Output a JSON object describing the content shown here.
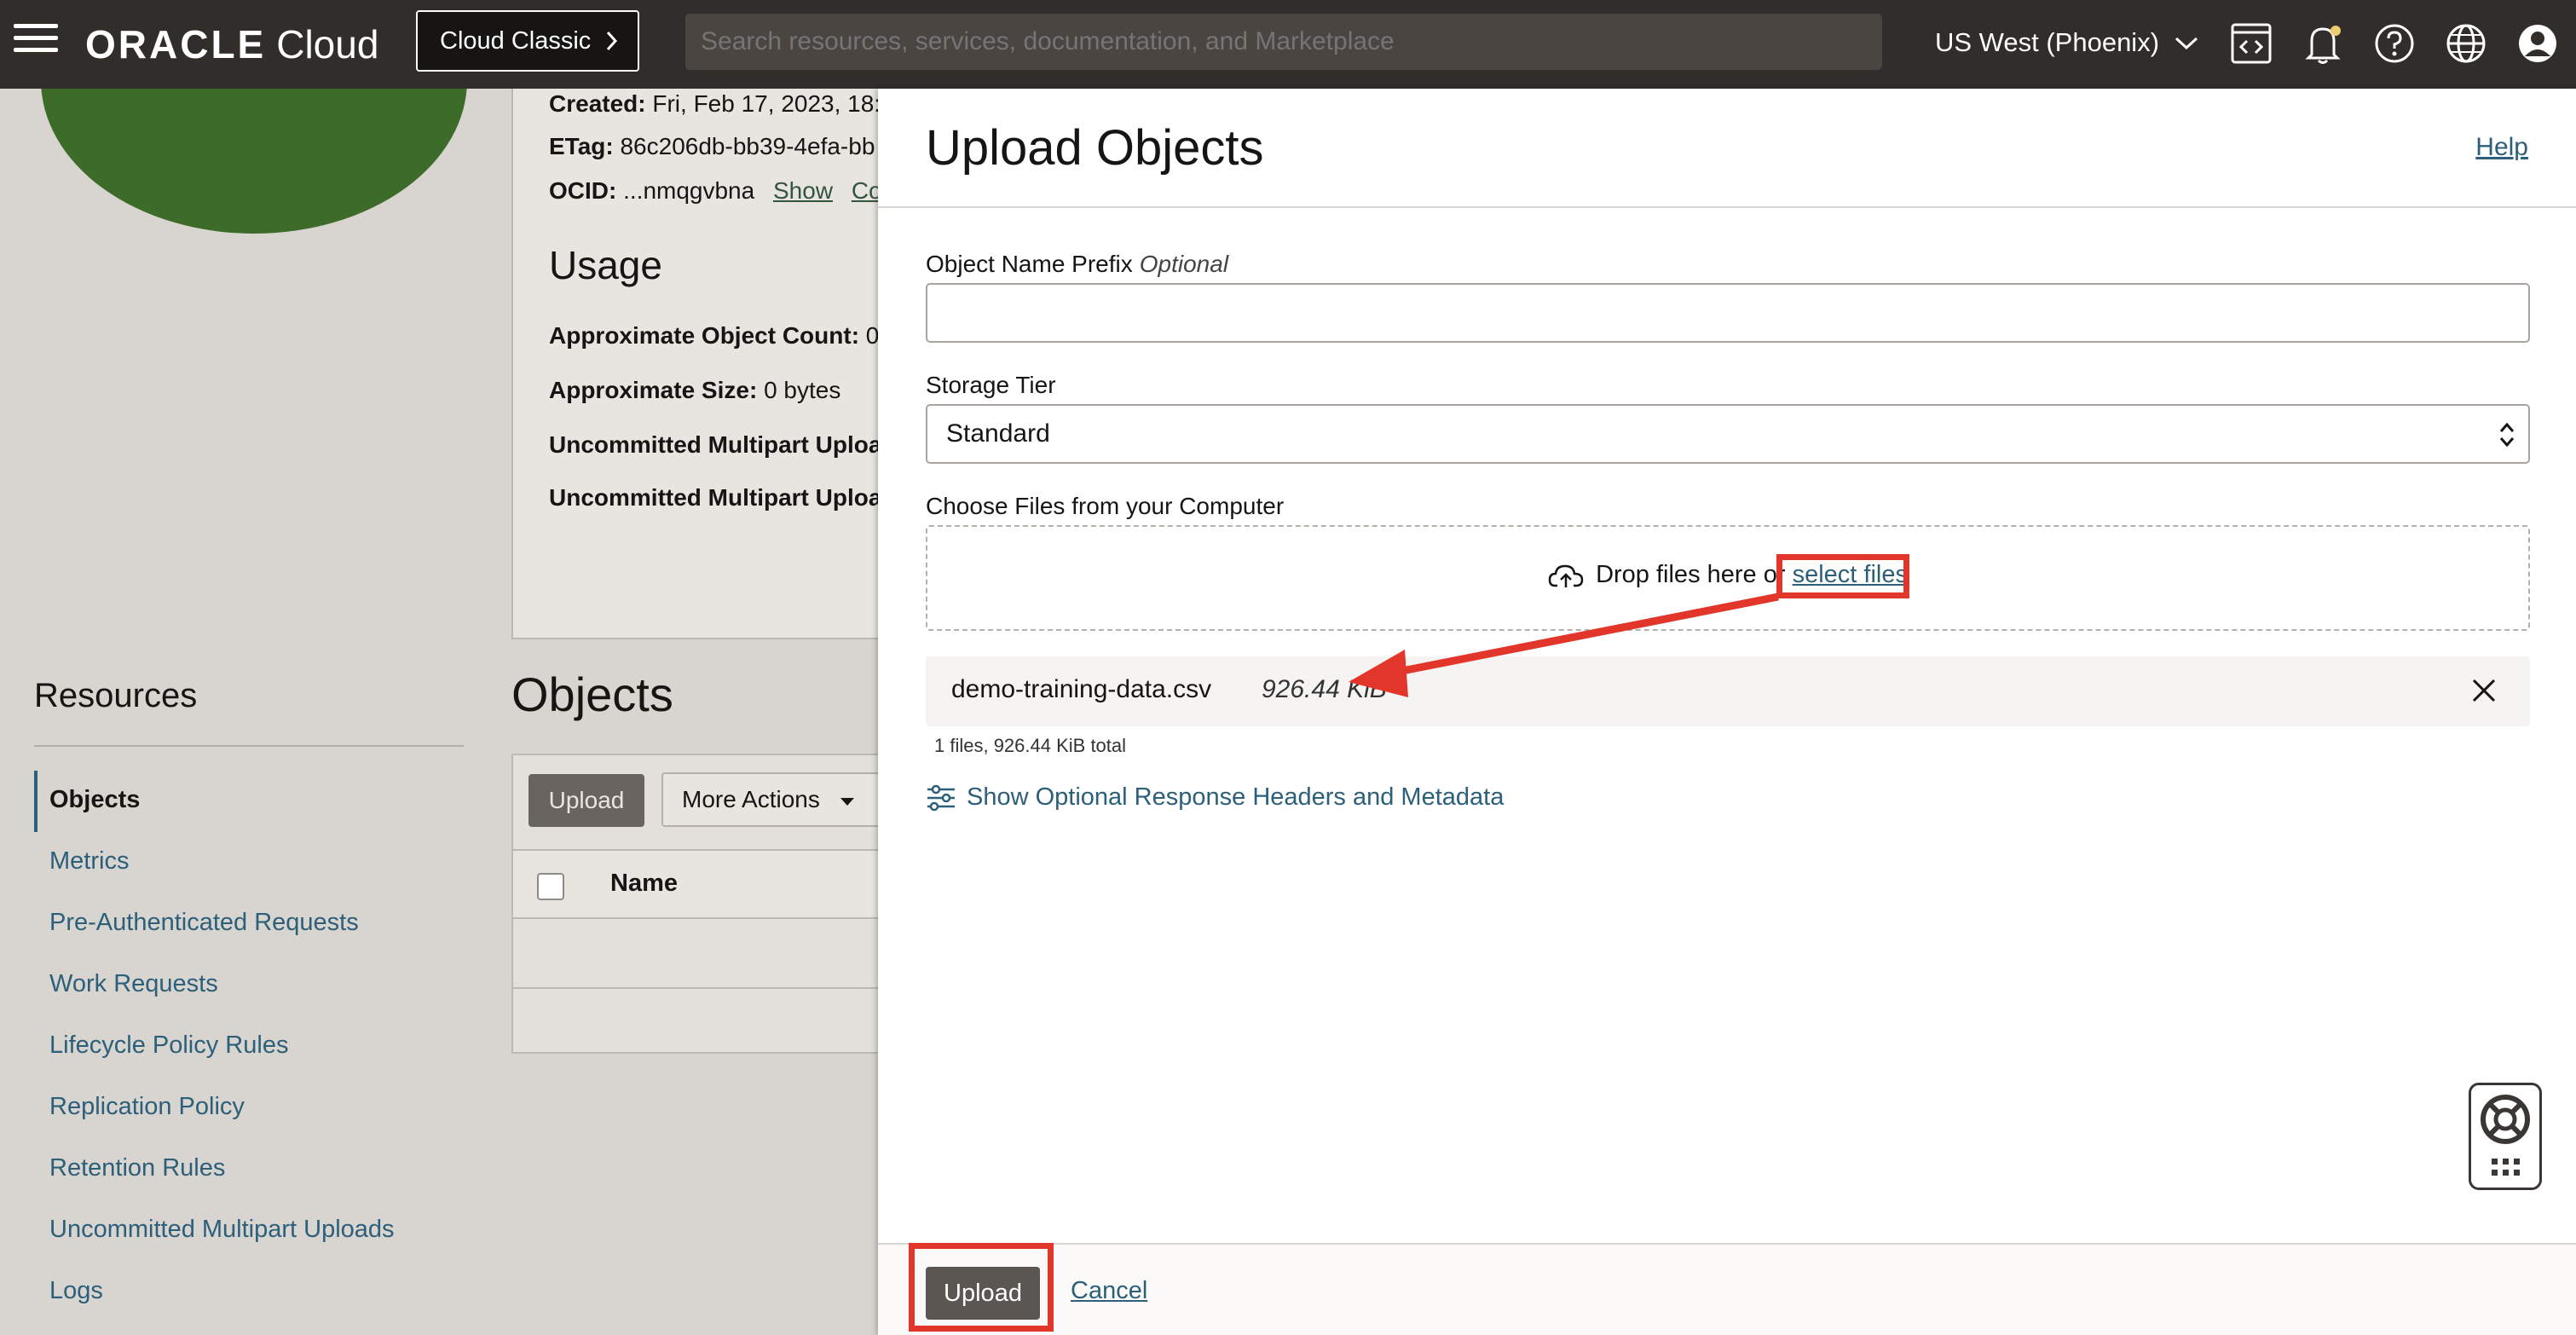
{
  "topbar": {
    "logo_brand": "ORACLE",
    "logo_product": "Cloud",
    "classic_label": "Cloud Classic",
    "search_placeholder": "Search resources, services, documentation, and Marketplace",
    "region": "US West (Phoenix)",
    "icons": [
      "menu-icon",
      "code-editor-icon",
      "bell-icon",
      "help-circle-icon",
      "globe-icon",
      "user-profile-icon"
    ]
  },
  "bucket_details": {
    "created_label": "Created:",
    "created_value": "Fri, Feb 17, 2023, 18:",
    "etag_label": "ETag:",
    "etag_value": "86c206db-bb39-4efa-bb",
    "ocid_label": "OCID:",
    "ocid_value": "...nmqgvbna",
    "ocid_show": "Show",
    "ocid_copy": "Co",
    "usage_title": "Usage",
    "approx_count_label": "Approximate Object Count:",
    "approx_count_value": "0",
    "approx_size_label": "Approximate Size:",
    "approx_size_value": "0 bytes",
    "uncommitted_1": "Uncommitted Multipart Uploa",
    "uncommitted_2": "Uncommitted Multipart Uploa"
  },
  "resources": {
    "title": "Resources",
    "items": [
      "Objects",
      "Metrics",
      "Pre-Authenticated Requests",
      "Work Requests",
      "Lifecycle Policy Rules",
      "Replication Policy",
      "Retention Rules",
      "Uncommitted Multipart Uploads",
      "Logs"
    ]
  },
  "objects_section": {
    "title": "Objects",
    "upload_label": "Upload",
    "more_actions_label": "More Actions",
    "name_header": "Name"
  },
  "panel": {
    "title": "Upload Objects",
    "help_label": "Help",
    "prefix_label": "Object Name Prefix",
    "prefix_optional": "Optional",
    "prefix_value": "",
    "storage_tier_label": "Storage Tier",
    "storage_tier_value": "Standard",
    "choose_files_label": "Choose Files from your Computer",
    "drop_text": "Drop files here or",
    "select_files_link": "select files",
    "file_name": "demo-training-data.csv",
    "file_size": "926.44 KiB",
    "total_text": "1 files, 926.44 KiB total",
    "optional_headers_link": "Show Optional Response Headers and Metadata",
    "upload_button": "Upload",
    "cancel_link": "Cancel"
  },
  "colors": {
    "topbar": "#312d2a",
    "link": "#2c5f7a",
    "annotation_red": "#e3362a",
    "button_dark": "#5b5652"
  }
}
